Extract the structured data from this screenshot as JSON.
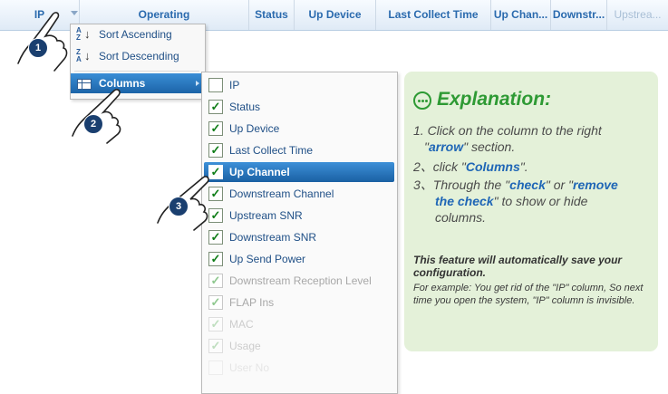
{
  "header": {
    "columns": [
      "IP",
      "Operating",
      "Status",
      "Up Device",
      "Last Collect Time",
      "Up Chan...",
      "Downstr...",
      "Upstrea..."
    ]
  },
  "sort_menu": {
    "sort_ascending": "Sort Ascending",
    "sort_descending": "Sort Descending",
    "columns": "Columns",
    "asc_icon": [
      "A",
      "Z"
    ],
    "desc_icon": [
      "Z",
      "A"
    ]
  },
  "columns_menu": {
    "items": [
      {
        "label": "IP",
        "checked": false
      },
      {
        "label": "Status",
        "checked": true
      },
      {
        "label": "Up Device",
        "checked": true
      },
      {
        "label": "Last Collect Time",
        "checked": true
      },
      {
        "label": "Up Channel",
        "checked": true
      },
      {
        "label": "Downstream Channel",
        "checked": true
      },
      {
        "label": "Upstream SNR",
        "checked": true
      },
      {
        "label": "Downstream SNR",
        "checked": true
      },
      {
        "label": "Up Send Power",
        "checked": true
      },
      {
        "label": "Downstream Reception Level",
        "checked": true
      },
      {
        "label": "FLAP Ins",
        "checked": true
      },
      {
        "label": "MAC",
        "checked": true
      },
      {
        "label": "Usage",
        "checked": true
      },
      {
        "label": "User No",
        "checked": false
      }
    ],
    "check_glyph": "✓"
  },
  "explanation": {
    "title": "Explanation:",
    "step1_a": "1. Click on the column to the right",
    "step1_b": "\"",
    "step1_kw": "arrow",
    "step1_c": "\" section.",
    "step2_a": "2、click \"",
    "step2_kw": "Columns",
    "step2_c": "\".",
    "step3_a": "3、Through the \"",
    "step3_kw1": "check",
    "step3_b": "\" or  \"",
    "step3_kw2": "remove",
    "step3_kw3": "the check",
    "step3_c": "\" to show or hide",
    "step3_d": "columns.",
    "note_heading": "This feature will automatically save your configuration.",
    "note_body": "For example: You get rid of the \"IP\" column, So next time you open the system, \"IP\" column is invisible."
  },
  "annotations": [
    "1",
    "2",
    "3"
  ],
  "colors": {
    "header_text": "#2a6aae",
    "accent_blue": "#1f66b6",
    "selection": "#1a60a3",
    "explanation_bg": "#e4f1d9",
    "explanation_title": "#2e9a34",
    "badge": "#1a3f6f"
  }
}
